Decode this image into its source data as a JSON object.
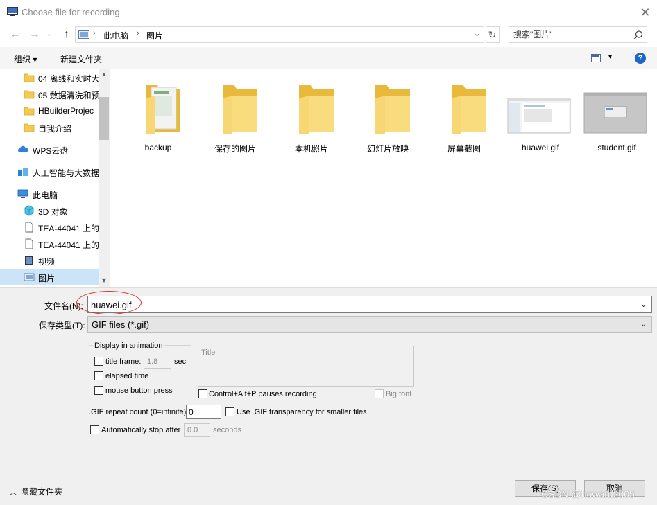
{
  "window": {
    "title": "Choose file for recording",
    "close_icon": "close-icon"
  },
  "nav": {
    "back_icon": "arrow-left-icon",
    "forward_icon": "arrow-right-icon",
    "recent_icon": "chevron-down-icon",
    "up_icon": "arrow-up-icon",
    "breadcrumbs": [
      "此电脑",
      "图片"
    ],
    "search_placeholder": "搜索\"图片\""
  },
  "toolbar": {
    "organize": "组织 ▾",
    "new_folder": "新建文件夹",
    "help": "?"
  },
  "sidebar": {
    "items": [
      {
        "label": "04 离线和实时大",
        "icon": "folder-icon"
      },
      {
        "label": "05 数据清洗和预",
        "icon": "folder-icon"
      },
      {
        "label": "HBuilderProjec",
        "icon": "folder-icon"
      },
      {
        "label": "自我介绍",
        "icon": "folder-icon"
      },
      {
        "label": "WPS云盘",
        "icon": "cloud-icon"
      },
      {
        "label": "人工智能与大数据",
        "icon": "cube-group-icon"
      },
      {
        "label": "此电脑",
        "icon": "computer-icon"
      },
      {
        "label": "3D 对象",
        "icon": "cube-icon"
      },
      {
        "label": "TEA-44041 上的",
        "icon": "document-icon"
      },
      {
        "label": "TEA-44041 上的",
        "icon": "document-icon"
      },
      {
        "label": "视频",
        "icon": "film-icon"
      },
      {
        "label": "图片",
        "icon": "pictures-icon"
      }
    ]
  },
  "files": [
    {
      "name": "backup",
      "type": "folder-with-doc"
    },
    {
      "name": "保存的图片",
      "type": "folder"
    },
    {
      "name": "本机照片",
      "type": "folder"
    },
    {
      "name": "幻灯片放映",
      "type": "folder"
    },
    {
      "name": "屏幕截图",
      "type": "folder"
    },
    {
      "name": "huawei.gif",
      "type": "image"
    },
    {
      "name": "student.gif",
      "type": "image"
    }
  ],
  "form": {
    "filename_label": "文件名(N):",
    "filename_value": "huawei.gif",
    "filetype_label": "保存类型(T):",
    "filetype_value": "GIF files (*.gif)",
    "display_group": "Display in animation",
    "title_frame": "title frame:",
    "title_frame_value": "1.8",
    "sec": "sec",
    "elapsed_time": "elapsed time",
    "mouse_press": "mouse button press",
    "title_placeholder": "Title",
    "ctrl_alt_p": "Control+Alt+P pauses recording",
    "big_font": "Big font",
    "repeat_label": ".GIF repeat count (0=infinite):",
    "repeat_value": "0",
    "transparency": "Use .GIF transparency for smaller files",
    "auto_stop": "Automatically stop after",
    "auto_stop_value": "0.0",
    "seconds": "seconds"
  },
  "footer": {
    "hide_folders": "隐藏文件夹",
    "save": "保存(S)",
    "cancel": "取消",
    "watermark": "CSDN @howard2005"
  }
}
